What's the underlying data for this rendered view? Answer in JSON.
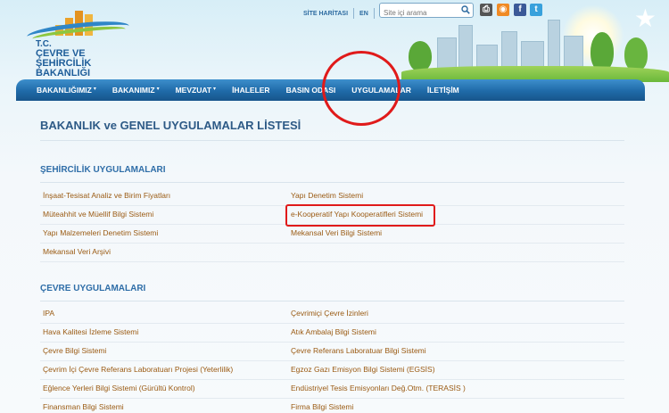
{
  "logo": {
    "line1": "T.C.",
    "line2": "ÇEVRE VE ŞEHİRCİLİK",
    "line3": "BAKANLIĞI"
  },
  "toplinks": {
    "sitemap": "SİTE HARİTASI",
    "lang": "EN"
  },
  "search": {
    "placeholder": "Site içi arama"
  },
  "nav": [
    {
      "label": "BAKANLIĞIMIZ",
      "dropdown": true
    },
    {
      "label": "BAKANIMIZ",
      "dropdown": true
    },
    {
      "label": "MEVZUAT",
      "dropdown": true
    },
    {
      "label": "İHALELER",
      "dropdown": false
    },
    {
      "label": "BASIN ODASI",
      "dropdown": false
    },
    {
      "label": "UYGULAMALAR",
      "dropdown": false
    },
    {
      "label": "İLETİŞİM",
      "dropdown": false
    }
  ],
  "colors": {
    "nav": "#1f6aa8",
    "link": "#9a5a12",
    "annotation": "#e01a1a",
    "title": "#2d5a86"
  },
  "page_title": "BAKANLIK ve GENEL UYGULAMALAR LİSTESİ",
  "sections": [
    {
      "title": "ŞEHİRCİLİK UYGULAMALARI",
      "rows": [
        [
          "İnşaat-Tesisat Analiz ve Birim Fiyatları",
          "Yapı Denetim Sistemi"
        ],
        [
          "Müteahhit ve Müellif Bilgi Sistemi",
          "e-Kooperatif Yapı Kooperatifleri Sistemi"
        ],
        [
          "Yapı Malzemeleri Denetim Sistemi",
          "Mekansal Veri Bilgi Sistemi"
        ],
        [
          "Mekansal Veri Arşivi",
          ""
        ]
      ]
    },
    {
      "title": "ÇEVRE UYGULAMALARI",
      "rows": [
        [
          "IPA",
          "Çevrimiçi Çevre İzinleri"
        ],
        [
          "Hava Kalitesi İzleme Sistemi",
          "Atık Ambalaj Bilgi Sistemi"
        ],
        [
          "Çevre Bilgi Sistemi",
          "Çevre Referans Laboratuar Bilgi Sistemi"
        ],
        [
          "Çevrim İçi Çevre Referans Laboratuarı Projesi (Yeterlilik)",
          "Egzoz Gazı Emisyon Bilgi Sistemi (EGSİS)"
        ],
        [
          "Eğlence Yerleri Bilgi Sistemi (Gürültü Kontrol)",
          "Endüstriyel Tesis Emisyonları Değ.Otm. (TERASİS )"
        ],
        [
          "Finansman Bilgi Sistemi",
          "Firma Bilgi Sistemi"
        ]
      ]
    }
  ]
}
